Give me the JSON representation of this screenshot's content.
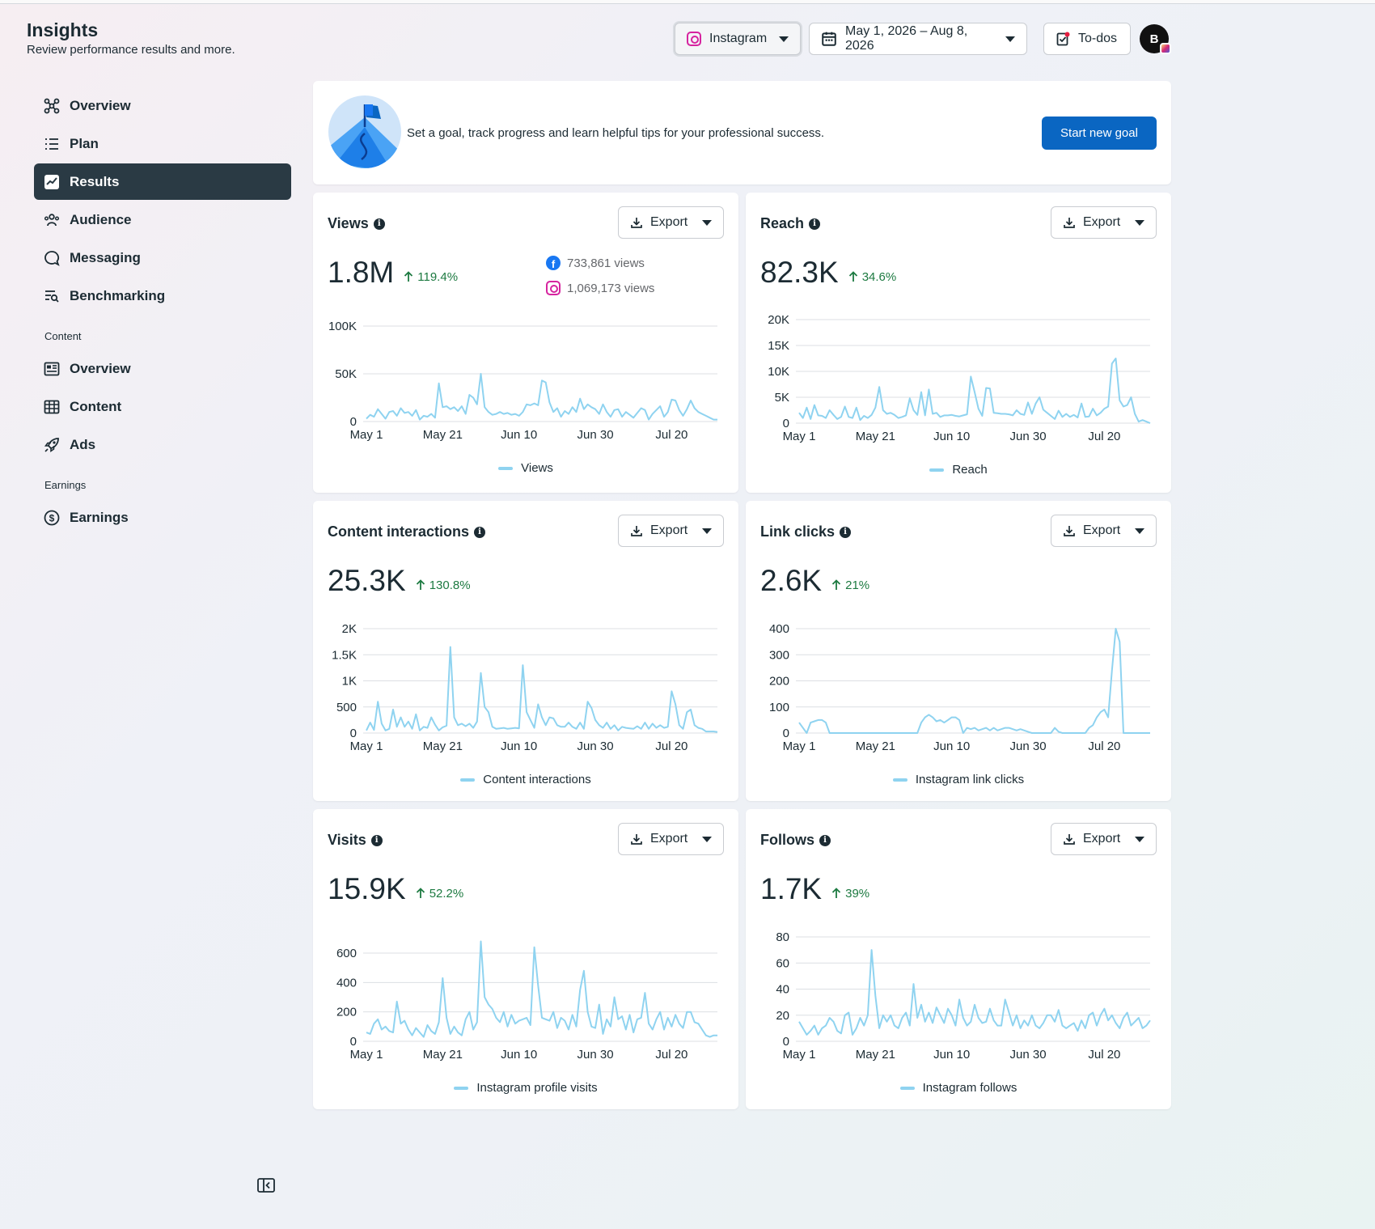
{
  "header": {
    "title": "Insights",
    "subtitle": "Review performance results and more.",
    "platform_label": "Instagram",
    "date_range_label": "May 1, 2026 – Aug 8, 2026",
    "todos_label": "To-dos",
    "avatar_initial": "B"
  },
  "sidebar": {
    "items": [
      {
        "label": "Overview",
        "icon": "network-icon"
      },
      {
        "label": "Plan",
        "icon": "list-icon"
      },
      {
        "label": "Results",
        "icon": "trend-chart-icon",
        "active": true
      },
      {
        "label": "Audience",
        "icon": "people-icon"
      },
      {
        "label": "Messaging",
        "icon": "chat-bubble-icon"
      },
      {
        "label": "Benchmarking",
        "icon": "benchmark-search-icon"
      }
    ],
    "content_section_label": "Content",
    "content_items": [
      {
        "label": "Overview",
        "icon": "newspaper-icon"
      },
      {
        "label": "Content",
        "icon": "table-icon"
      },
      {
        "label": "Ads",
        "icon": "rocket-icon"
      }
    ],
    "earnings_section_label": "Earnings",
    "earnings_items": [
      {
        "label": "Earnings",
        "icon": "dollar-circle-icon"
      }
    ]
  },
  "goal_banner": {
    "text": "Set a goal, track progress and learn helpful tips for your professional success.",
    "button_label": "Start new goal"
  },
  "export_label": "Export",
  "colors": {
    "accent": "#0a66c2",
    "line": "#8fd3f0",
    "positive": "#1d7a41",
    "active_nav": "#2a3a44"
  },
  "chart_data": [
    {
      "type": "line",
      "title": "Views",
      "value": "1.8M",
      "change": "119.4%",
      "breakdown": [
        {
          "platform": "facebook",
          "text": "733,861 views"
        },
        {
          "platform": "instagram",
          "text": "1,069,173 views"
        }
      ],
      "x_tick_labels": [
        "May 1",
        "May 21",
        "Jun 10",
        "Jun 30",
        "Jul 20"
      ],
      "y_ticks": [
        0,
        50000,
        100000
      ],
      "y_tick_labels": [
        "0",
        "50K",
        "100K"
      ],
      "ylim": [
        0,
        100000
      ],
      "series": [
        {
          "name": "Views",
          "values": [
            3000,
            7000,
            5000,
            13000,
            8000,
            3000,
            10000,
            11000,
            6000,
            14000,
            9000,
            10000,
            6000,
            12000,
            2000,
            6000,
            5000,
            8000,
            4000,
            40000,
            15000,
            16000,
            13000,
            15000,
            11000,
            16000,
            8000,
            28000,
            25000,
            18000,
            50000,
            15000,
            10000,
            7000,
            8000,
            10000,
            8000,
            9000,
            7000,
            8000,
            6000,
            10000,
            18000,
            17000,
            19000,
            17000,
            43000,
            41000,
            20000,
            10000,
            14000,
            5000,
            11000,
            8000,
            15000,
            10000,
            24000,
            13000,
            18000,
            15000,
            13000,
            8000,
            18000,
            10000,
            5000,
            12000,
            13000,
            5000,
            10000,
            7000,
            4000,
            9000,
            14000,
            12000,
            2000,
            8000,
            12000,
            16000,
            5000,
            10000,
            23000,
            22000,
            12000,
            6000,
            13000,
            22000,
            14000,
            10000,
            8000,
            6000,
            4000,
            2000,
            2000
          ]
        }
      ]
    },
    {
      "type": "line",
      "title": "Reach",
      "value": "82.3K",
      "change": "34.6%",
      "x_tick_labels": [
        "May 1",
        "May 21",
        "Jun 10",
        "Jun 30",
        "Jul 20"
      ],
      "y_ticks": [
        0,
        5000,
        10000,
        15000,
        20000
      ],
      "y_tick_labels": [
        "0",
        "5K",
        "10K",
        "15K",
        "20K"
      ],
      "ylim": [
        0,
        20000
      ],
      "series": [
        {
          "name": "Reach",
          "values": [
            2000,
            1000,
            3000,
            800,
            3500,
            1500,
            1400,
            1000,
            2500,
            1600,
            800,
            1200,
            3200,
            1200,
            1000,
            3000,
            600,
            1400,
            1000,
            1600,
            3000,
            7000,
            2500,
            1800,
            2000,
            1600,
            1000,
            1200,
            1500,
            4800,
            2500,
            1600,
            6000,
            1500,
            6500,
            1800,
            2000,
            1200,
            1500,
            1500,
            1600,
            1400,
            1300,
            1500,
            1700,
            9000,
            6000,
            2800,
            1400,
            6800,
            6700,
            2000,
            1900,
            1800,
            1800,
            1700,
            1500,
            2500,
            1800,
            1600,
            4000,
            1800,
            3800,
            5000,
            2600,
            2000,
            1400,
            800,
            2400,
            1200,
            1800,
            1200,
            1600,
            1100,
            3800,
            1200,
            1300,
            2800,
            1500,
            2000,
            2800,
            3200,
            11500,
            12500,
            4400,
            3200,
            3500,
            5000,
            1800,
            300,
            600,
            300,
            0
          ]
        }
      ]
    },
    {
      "type": "line",
      "title": "Content interactions",
      "value": "25.3K",
      "change": "130.8%",
      "x_tick_labels": [
        "May 1",
        "May 21",
        "Jun 10",
        "Jun 30",
        "Jul 20"
      ],
      "y_ticks": [
        0,
        500,
        1000,
        1500,
        2000
      ],
      "y_tick_labels": [
        "0",
        "500",
        "1K",
        "1.5K",
        "2K"
      ],
      "ylim": [
        0,
        2000
      ],
      "series": [
        {
          "name": "Content interactions",
          "values": [
            50,
            200,
            60,
            600,
            180,
            50,
            80,
            450,
            120,
            300,
            120,
            220,
            80,
            360,
            50,
            120,
            100,
            300,
            160,
            50,
            110,
            140,
            1650,
            300,
            150,
            180,
            130,
            180,
            100,
            220,
            1150,
            500,
            400,
            120,
            80,
            90,
            100,
            80,
            90,
            100,
            90,
            1300,
            400,
            250,
            100,
            550,
            300,
            150,
            300,
            280,
            150,
            120,
            120,
            200,
            120,
            80,
            200,
            80,
            600,
            480,
            250,
            150,
            100,
            200,
            80,
            150,
            50,
            120,
            100,
            90,
            80,
            130,
            80,
            200,
            80,
            180,
            100,
            150,
            100,
            120,
            800,
            550,
            150,
            80,
            400,
            450,
            150,
            100,
            80,
            30,
            30,
            30,
            20
          ]
        }
      ]
    },
    {
      "type": "line",
      "title": "Link clicks",
      "value": "2.6K",
      "change": "21%",
      "x_tick_labels": [
        "May 1",
        "May 21",
        "Jun 10",
        "Jun 30",
        "Jul 20"
      ],
      "y_ticks": [
        0,
        100,
        200,
        300,
        400
      ],
      "y_tick_labels": [
        "0",
        "100",
        "200",
        "300",
        "400"
      ],
      "ylim": [
        0,
        400
      ],
      "series": [
        {
          "name": "Instagram link clicks",
          "values": [
            40,
            20,
            0,
            40,
            45,
            50,
            50,
            40,
            0,
            0,
            0,
            0,
            0,
            0,
            0,
            0,
            0,
            0,
            0,
            0,
            0,
            0,
            0,
            0,
            0,
            0,
            0,
            0,
            0,
            0,
            0,
            0,
            40,
            60,
            70,
            60,
            45,
            50,
            40,
            50,
            60,
            60,
            50,
            0,
            20,
            15,
            20,
            10,
            15,
            20,
            10,
            20,
            10,
            15,
            20,
            20,
            15,
            10,
            15,
            10,
            5,
            0,
            0,
            0,
            0,
            0,
            0,
            20,
            5,
            0,
            0,
            0,
            0,
            0,
            0,
            0,
            20,
            30,
            60,
            80,
            90,
            60,
            240,
            400,
            350,
            0,
            0,
            0,
            0,
            0,
            0,
            0,
            0
          ]
        }
      ]
    },
    {
      "type": "line",
      "title": "Visits",
      "value": "15.9K",
      "change": "52.2%",
      "x_tick_labels": [
        "May 1",
        "May 21",
        "Jun 10",
        "Jun 30",
        "Jul 20"
      ],
      "y_ticks": [
        0,
        200,
        400,
        600
      ],
      "y_tick_labels": [
        "0",
        "200",
        "400",
        "600"
      ],
      "ylim": [
        0,
        600
      ],
      "series": [
        {
          "name": "Instagram profile visits",
          "values": [
            60,
            50,
            120,
            150,
            80,
            100,
            70,
            60,
            270,
            120,
            140,
            80,
            40,
            90,
            60,
            30,
            110,
            70,
            50,
            130,
            430,
            160,
            50,
            100,
            60,
            40,
            150,
            200,
            80,
            130,
            680,
            300,
            250,
            220,
            160,
            130,
            200,
            100,
            180,
            120,
            140,
            150,
            160,
            110,
            640,
            380,
            160,
            150,
            140,
            200,
            90,
            160,
            140,
            80,
            180,
            100,
            350,
            480,
            200,
            100,
            90,
            250,
            50,
            150,
            100,
            300,
            150,
            170,
            80,
            180,
            60,
            150,
            160,
            330,
            120,
            80,
            150,
            200,
            80,
            160,
            100,
            180,
            120,
            90,
            200,
            200,
            130,
            120,
            80,
            40,
            30,
            40,
            40
          ]
        }
      ]
    },
    {
      "type": "line",
      "title": "Follows",
      "value": "1.7K",
      "change": "39%",
      "x_tick_labels": [
        "May 1",
        "May 21",
        "Jun 10",
        "Jun 30",
        "Jul 20"
      ],
      "y_ticks": [
        0,
        20,
        40,
        60,
        80
      ],
      "y_tick_labels": [
        "0",
        "20",
        "40",
        "60",
        "80"
      ],
      "ylim": [
        0,
        80
      ],
      "series": [
        {
          "name": "Instagram follows",
          "values": [
            15,
            10,
            5,
            8,
            12,
            5,
            10,
            12,
            18,
            15,
            8,
            6,
            20,
            22,
            5,
            10,
            18,
            12,
            20,
            70,
            35,
            10,
            20,
            15,
            20,
            12,
            10,
            18,
            22,
            12,
            44,
            18,
            28,
            15,
            22,
            14,
            26,
            20,
            14,
            25,
            20,
            12,
            32,
            18,
            12,
            15,
            28,
            18,
            14,
            15,
            25,
            16,
            12,
            12,
            32,
            22,
            12,
            20,
            10,
            16,
            12,
            20,
            12,
            10,
            14,
            20,
            20,
            15,
            24,
            12,
            10,
            12,
            14,
            8,
            16,
            10,
            20,
            22,
            12,
            20,
            25,
            16,
            20,
            14,
            10,
            18,
            22,
            12,
            15,
            18,
            10,
            12,
            16
          ]
        }
      ]
    }
  ]
}
